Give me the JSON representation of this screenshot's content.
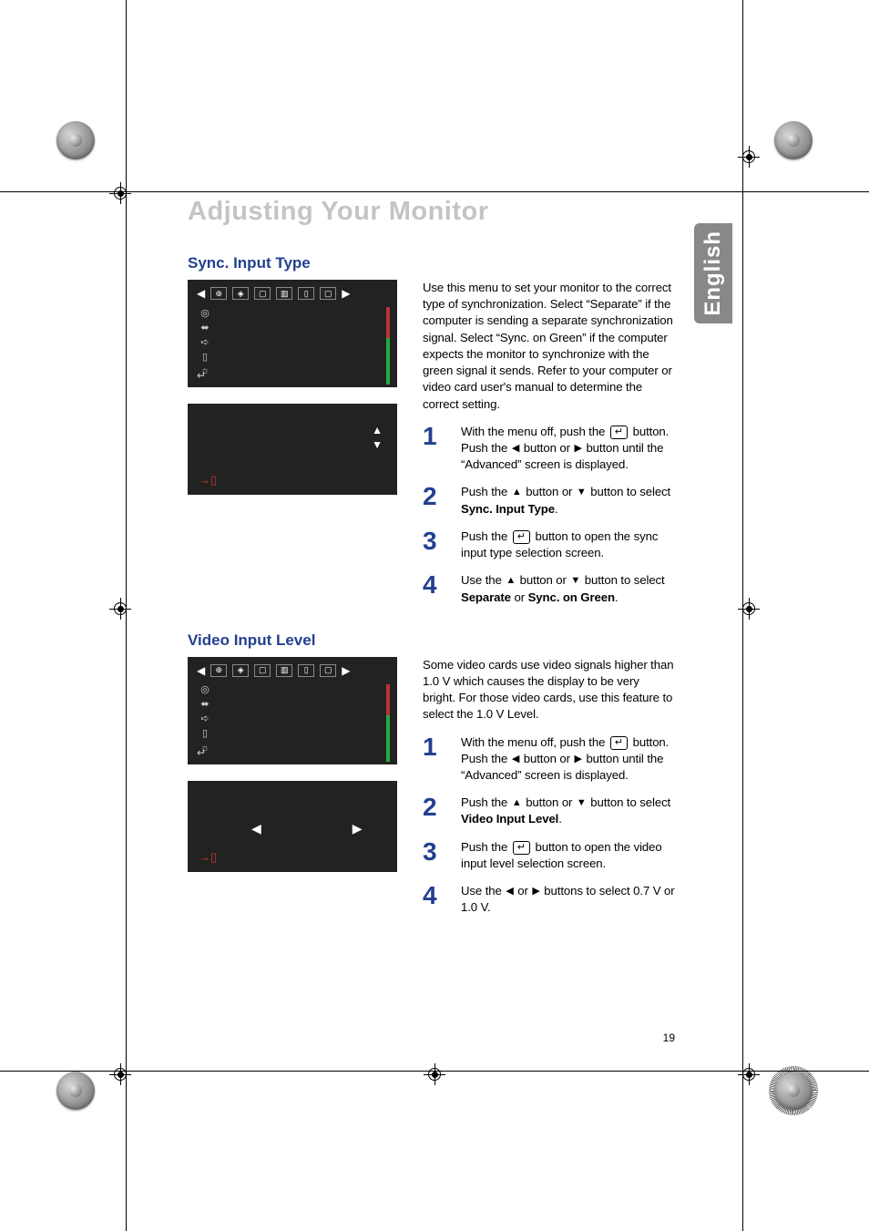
{
  "chapter_title": "Adjusting Your Monitor",
  "language_tab": "English",
  "page_number": "19",
  "sections": [
    {
      "title": "Sync. Input Type",
      "intro": "Use this menu to set your monitor to the correct type of synchronization. Select “Separate” if the computer is sending a separate synchronization signal. Select “Sync. on Green” if the computer expects the monitor to synchronize with the green signal it sends. Refer to your computer or video card user's manual to determine the correct setting.",
      "steps": [
        {
          "n": "1",
          "pre": "With the menu off, push the ",
          "icon": "enter",
          "mid": " button. Push the ",
          "arr1": "◀",
          "mid2": " button or ",
          "arr2": "▶",
          "post": " button until the “Advanced” screen is displayed."
        },
        {
          "n": "2",
          "pre": "Push the ",
          "arr1": "▲",
          "mid": " button or ",
          "arr2": "▼",
          "post": " button to select ",
          "bold": "Sync. Input Type",
          "tail": "."
        },
        {
          "n": "3",
          "pre": "Push the ",
          "icon": "enter",
          "post": " button to open the sync input type selection screen."
        },
        {
          "n": "4",
          "pre": "Use the ",
          "arr1": "▲",
          "mid": " button or ",
          "arr2": "▼",
          "post": " button to select ",
          "bold": "Separate",
          "mid2": " or ",
          "bold2": "Sync. on Green",
          "tail": "."
        }
      ],
      "osd_sub_type": "vert"
    },
    {
      "title": "Video Input Level",
      "intro": "Some video cards use video signals higher than 1.0 V which causes the display to be very bright. For those video cards, use this feature to select the 1.0 V Level.",
      "steps": [
        {
          "n": "1",
          "pre": "With the menu off, push the ",
          "icon": "enter",
          "mid": " button. Push the ",
          "arr1": "◀",
          "mid2": " button or ",
          "arr2": "▶",
          "post": " button until the “Advanced” screen is displayed."
        },
        {
          "n": "2",
          "pre": "Push the ",
          "arr1": "▲",
          "mid": " button or ",
          "arr2": "▼",
          "post": " button to select ",
          "bold": "Video Input Level",
          "tail": "."
        },
        {
          "n": "3",
          "pre": "Push the ",
          "icon": "enter",
          "post": " button to open the video input level selection screen."
        },
        {
          "n": "4",
          "pre": "Use the ",
          "arr1": "◀",
          "mid": " or ",
          "arr2": "▶",
          "post": " buttons to select 0.7 V or 1.0 V."
        }
      ],
      "osd_sub_type": "horiz"
    }
  ],
  "osd": {
    "top_icons": [
      "◀",
      "⊕",
      "◈",
      "▢",
      "▥",
      "▯",
      "▢",
      "▶"
    ],
    "left_icons": [
      "◎",
      "⬌",
      "➪",
      "▯",
      "☼"
    ],
    "enter_glyph": "↵",
    "exit_glyph": "→▯"
  }
}
